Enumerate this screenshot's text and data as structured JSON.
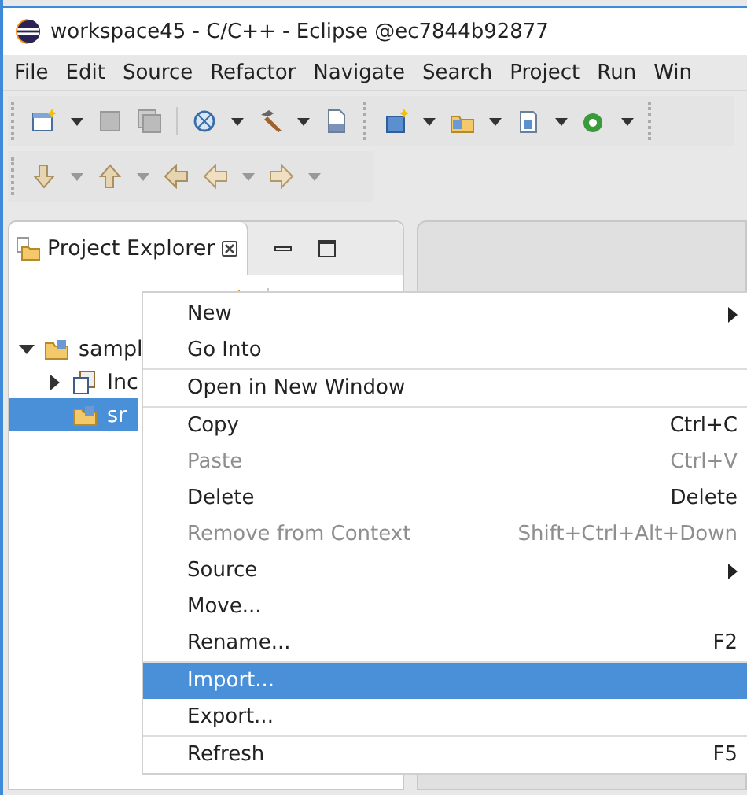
{
  "window": {
    "title": "workspace45 - C/C++ - Eclipse @ec7844b92877"
  },
  "menu_bar": [
    "File",
    "Edit",
    "Source",
    "Refactor",
    "Navigate",
    "Search",
    "Project",
    "Run",
    "Win"
  ],
  "project_explorer": {
    "tab": "Project Explorer",
    "tree": [
      {
        "label": "sampl",
        "expanded": true,
        "selected": false,
        "children": [
          {
            "label": "Inc",
            "expanded": false,
            "selected": false
          },
          {
            "label": "sr",
            "selected": true
          }
        ]
      }
    ]
  },
  "context_menu": [
    {
      "kind": "item",
      "label": "New",
      "submenu": true,
      "disabled": false,
      "selected": false
    },
    {
      "kind": "item",
      "label": "Go Into",
      "disabled": false,
      "selected": false
    },
    {
      "kind": "separator"
    },
    {
      "kind": "item",
      "label": "Open in New Window",
      "disabled": false,
      "selected": false
    },
    {
      "kind": "separator"
    },
    {
      "kind": "item",
      "label": "Copy",
      "shortcut": "Ctrl+C",
      "disabled": false,
      "selected": false
    },
    {
      "kind": "item",
      "label": "Paste",
      "shortcut": "Ctrl+V",
      "disabled": true,
      "selected": false
    },
    {
      "kind": "item",
      "label": "Delete",
      "shortcut": "Delete",
      "disabled": false,
      "selected": false
    },
    {
      "kind": "item",
      "label": "Remove from Context",
      "shortcut": "Shift+Ctrl+Alt+Down",
      "disabled": true,
      "selected": false
    },
    {
      "kind": "item",
      "label": "Source",
      "submenu": true,
      "disabled": false,
      "selected": false
    },
    {
      "kind": "item",
      "label": "Move...",
      "disabled": false,
      "selected": false
    },
    {
      "kind": "item",
      "label": "Rename...",
      "shortcut": "F2",
      "disabled": false,
      "selected": false
    },
    {
      "kind": "separator"
    },
    {
      "kind": "item",
      "label": "Import...",
      "disabled": false,
      "selected": true
    },
    {
      "kind": "item",
      "label": "Export...",
      "disabled": false,
      "selected": false
    },
    {
      "kind": "separator"
    },
    {
      "kind": "item",
      "label": "Refresh",
      "shortcut": "F5",
      "disabled": false,
      "selected": false
    }
  ]
}
